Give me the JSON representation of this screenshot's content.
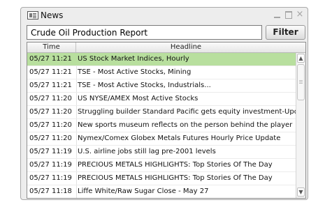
{
  "window": {
    "title": "News",
    "close_glyph": "×",
    "icons": [
      "news-app-icon",
      "minimize-icon",
      "maximize-icon",
      "close-icon"
    ]
  },
  "search": {
    "value": "Crude Oil Production Report",
    "filter_label": "Filter"
  },
  "table": {
    "columns": [
      "Time",
      "Headline"
    ],
    "selected_index": 0,
    "selected_color": "#b8df9e",
    "rows": [
      {
        "time": "05/27 11:21",
        "headline": "US Stock Market Indices, Hourly"
      },
      {
        "time": "05/27 11:21",
        "headline": "TSE - Most Active Stocks, Mining"
      },
      {
        "time": "05/27 11:21",
        "headline": "TSE - Most Active Stocks, Industrials..."
      },
      {
        "time": "05/27 11:20",
        "headline": "US NYSE/AMEX Most Active Stocks"
      },
      {
        "time": "05/27 11:20",
        "headline": "Struggling builder Standard Pacific gets equity investment-Update"
      },
      {
        "time": "05/27 11:20",
        "headline": "New sports museum reflects on the person behind the player"
      },
      {
        "time": "05/27 11:20",
        "headline": "Nymex/Comex Globex Metals Futures Hourly Price Update"
      },
      {
        "time": "05/27 11:19",
        "headline": "U.S. airline jobs still lag pre-2001 levels"
      },
      {
        "time": "05/27 11:19",
        "headline": "PRECIOUS METALS HIGHLIGHTS: Top Stories Of The Day"
      },
      {
        "time": "05/27 11:19",
        "headline": "PRECIOUS METALS HIGHLIGHTS: Top Stories Of The Day"
      },
      {
        "time": "05/27 11:18",
        "headline": "Liffe White/Raw Sugar Close - May 27"
      }
    ]
  },
  "scrollbar": {
    "up_glyph": "▲",
    "down_glyph": "▼"
  }
}
